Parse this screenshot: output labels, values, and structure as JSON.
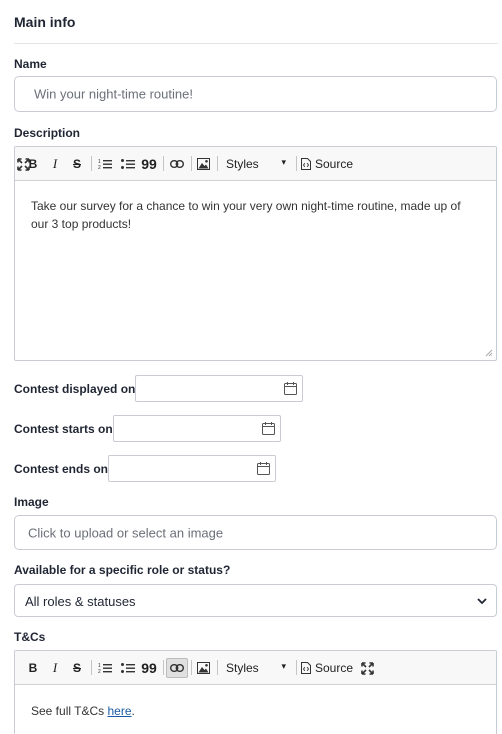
{
  "section": {
    "title": "Main info"
  },
  "name": {
    "label": "Name",
    "value": "Win your night-time routine!"
  },
  "description": {
    "label": "Description",
    "toolbar": {
      "bold": "B",
      "italic": "I",
      "strike": "S",
      "quote": "99",
      "styles": "Styles",
      "source": "Source"
    },
    "body": "Take our survey for a chance to win your very own night-time routine, made up of our 3 top products!"
  },
  "dates": {
    "displayed_label": "Contest displayed on",
    "starts_label": "Contest starts on",
    "ends_label": "Contest ends on"
  },
  "image": {
    "label": "Image",
    "placeholder": "Click to upload or select an image"
  },
  "role": {
    "label": "Available for a specific role or status?",
    "selected": "All roles & statuses"
  },
  "tcs": {
    "label": "T&Cs",
    "toolbar": {
      "bold": "B",
      "italic": "I",
      "strike": "S",
      "quote": "99",
      "styles": "Styles",
      "source": "Source"
    },
    "body_prefix": "See full T&Cs ",
    "link_text": "here",
    "body_suffix": "."
  }
}
